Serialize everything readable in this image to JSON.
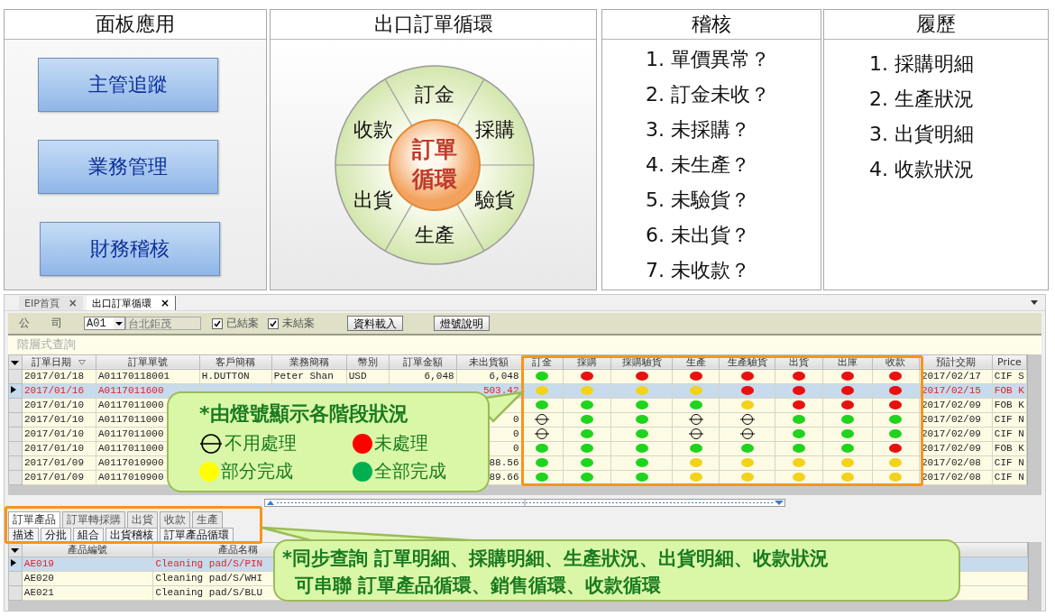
{
  "dashboard": {
    "panel_apps": {
      "title": "面板應用",
      "buttons": [
        "主管追蹤",
        "業務管理",
        "財務稽核"
      ]
    },
    "cycle": {
      "title": "出口訂單循環",
      "center": "訂單循環",
      "segments": [
        "訂金",
        "採購",
        "驗貨",
        "生產",
        "出貨",
        "收款"
      ]
    },
    "audit": {
      "title": "稽核",
      "items": [
        "1. 單價異常？",
        "2. 訂金未收？",
        "3. 未採購？",
        "4. 未生產？",
        "5. 未驗貨？",
        "6. 未出貨？",
        "7. 未收款？"
      ]
    },
    "history": {
      "title": "履歷",
      "items": [
        "1. 採購明細",
        "2. 生產狀況",
        "3. 出貨明細",
        "4. 收款狀況"
      ]
    }
  },
  "app": {
    "tabs": [
      {
        "label": "EIP首頁",
        "close": "×",
        "selected": false
      },
      {
        "label": "出口訂單循環",
        "close": "×",
        "selected": true
      }
    ],
    "toolbar": {
      "company_label": "公　　司",
      "company_code": "A01",
      "company_name": "台北鉅茂",
      "filters": [
        {
          "label": "已結案",
          "checked": true
        },
        {
          "label": "未結案",
          "checked": true
        }
      ],
      "buttons": [
        "資料載入",
        "燈號說明"
      ]
    },
    "group_hint": "階層式查詢",
    "orders": {
      "columns": [
        {
          "label": "訂單日期",
          "kind": "text",
          "sortable": true
        },
        {
          "label": "訂單單號",
          "kind": "text",
          "sortable": false
        },
        {
          "label": "客戶簡稱",
          "kind": "text",
          "sortable": false
        },
        {
          "label": "業務簡稱",
          "kind": "text",
          "sortable": false
        },
        {
          "label": "幣別",
          "kind": "text",
          "sortable": false
        },
        {
          "label": "訂單金額",
          "kind": "number",
          "sortable": false
        },
        {
          "label": "未出貨額",
          "kind": "number",
          "sortable": false
        },
        {
          "label": "訂金",
          "kind": "light",
          "sortable": false
        },
        {
          "label": "採購",
          "kind": "light",
          "sortable": false
        },
        {
          "label": "採購驗貨",
          "kind": "light",
          "sortable": false
        },
        {
          "label": "生產",
          "kind": "light",
          "sortable": false
        },
        {
          "label": "生產驗貨",
          "kind": "light",
          "sortable": false
        },
        {
          "label": "出貨",
          "kind": "light",
          "sortable": false
        },
        {
          "label": "出庫",
          "kind": "light",
          "sortable": false
        },
        {
          "label": "收款",
          "kind": "light",
          "sortable": false
        },
        {
          "label": "預計交期",
          "kind": "text",
          "sortable": false
        },
        {
          "label": "Price",
          "kind": "text",
          "sortable": false
        }
      ],
      "rows": [
        {
          "selected": false,
          "cells": [
            "2017/01/18",
            "A01170118001",
            "H.DUTTON",
            "Peter Shan",
            "USD",
            "6,048",
            "6,048",
            {
              "kind": "dot",
              "color": "#1ed41e"
            },
            {
              "kind": "dot",
              "color": "#e81010"
            },
            {
              "kind": "dot",
              "color": "#e81010"
            },
            {
              "kind": "dot",
              "color": "#e81010"
            },
            {
              "kind": "dot",
              "color": "#e81010"
            },
            {
              "kind": "dot",
              "color": "#e81010"
            },
            {
              "kind": "dot",
              "color": "#e81010"
            },
            {
              "kind": "dot",
              "color": "#e81010"
            },
            "2017/02/17",
            "CIF S"
          ]
        },
        {
          "selected": true,
          "cells": [
            "2017/01/16",
            "A0117011600",
            null,
            null,
            null,
            null,
            "503.42",
            {
              "kind": "dot",
              "color": "#f2d21b"
            },
            {
              "kind": "dot",
              "color": "#f2d21b"
            },
            {
              "kind": "dot",
              "color": "#f2d21b"
            },
            {
              "kind": "dot",
              "color": "#f2d21b"
            },
            {
              "kind": "dot",
              "color": "#e81010"
            },
            {
              "kind": "dot",
              "color": "#e81010"
            },
            {
              "kind": "dot",
              "color": "#e81010"
            },
            {
              "kind": "dot",
              "color": "#e81010"
            },
            "2017/02/15",
            "FOB K"
          ]
        },
        {
          "selected": false,
          "cells": [
            "2017/01/10",
            "A0117011000",
            null,
            null,
            null,
            null,
            null,
            {
              "kind": "dot",
              "color": "#1ed41e"
            },
            {
              "kind": "dot",
              "color": "#1ed41e"
            },
            {
              "kind": "dot",
              "color": "#1ed41e"
            },
            {
              "kind": "dot",
              "color": "#1ed41e"
            },
            {
              "kind": "dot",
              "color": "#f2d21b"
            },
            {
              "kind": "dot",
              "color": "#e81010"
            },
            {
              "kind": "dot",
              "color": "#e81010"
            },
            {
              "kind": "dot",
              "color": "#e81010"
            },
            "2017/02/09",
            "FOB K"
          ]
        },
        {
          "selected": false,
          "cells": [
            "2017/01/10",
            "A0117011000",
            null,
            null,
            null,
            null,
            "0",
            {
              "kind": "none"
            },
            {
              "kind": "dot",
              "color": "#1ed41e"
            },
            {
              "kind": "dot",
              "color": "#1ed41e"
            },
            {
              "kind": "none"
            },
            {
              "kind": "none"
            },
            {
              "kind": "dot",
              "color": "#1ed41e"
            },
            {
              "kind": "dot",
              "color": "#1ed41e"
            },
            {
              "kind": "dot",
              "color": "#1ed41e"
            },
            "2017/02/09",
            "CIF N"
          ]
        },
        {
          "selected": false,
          "cells": [
            "2017/01/10",
            "A0117011000",
            null,
            null,
            null,
            null,
            "0",
            {
              "kind": "none"
            },
            {
              "kind": "dot",
              "color": "#1ed41e"
            },
            {
              "kind": "dot",
              "color": "#1ed41e"
            },
            {
              "kind": "none"
            },
            {
              "kind": "none"
            },
            {
              "kind": "dot",
              "color": "#1ed41e"
            },
            {
              "kind": "dot",
              "color": "#1ed41e"
            },
            {
              "kind": "dot",
              "color": "#1ed41e"
            },
            "2017/02/09",
            "CIF N"
          ]
        },
        {
          "selected": false,
          "cells": [
            "2017/01/10",
            "A0117011000",
            null,
            null,
            null,
            null,
            "0",
            {
              "kind": "dot",
              "color": "#1ed41e"
            },
            {
              "kind": "dot",
              "color": "#1ed41e"
            },
            {
              "kind": "dot",
              "color": "#1ed41e"
            },
            {
              "kind": "dot",
              "color": "#1ed41e"
            },
            {
              "kind": "dot",
              "color": "#1ed41e"
            },
            {
              "kind": "dot",
              "color": "#1ed41e"
            },
            {
              "kind": "dot",
              "color": "#1ed41e"
            },
            {
              "kind": "dot",
              "color": "#e81010"
            },
            "2017/02/09",
            "FOB K"
          ]
        },
        {
          "selected": false,
          "cells": [
            "2017/01/09",
            "A0117010900",
            null,
            null,
            null,
            null,
            "88.56",
            {
              "kind": "dot",
              "color": "#1ed41e"
            },
            {
              "kind": "dot",
              "color": "#1ed41e"
            },
            {
              "kind": "dot",
              "color": "#1ed41e"
            },
            {
              "kind": "dot",
              "color": "#f2d21b"
            },
            {
              "kind": "dot",
              "color": "#f2d21b"
            },
            {
              "kind": "dot",
              "color": "#f2d21b"
            },
            {
              "kind": "dot",
              "color": "#f2d21b"
            },
            {
              "kind": "dot",
              "color": "#f2d21b"
            },
            "2017/02/08",
            "CIF N"
          ]
        },
        {
          "selected": false,
          "cells": [
            "2017/01/09",
            "A0117010900",
            null,
            null,
            null,
            null,
            "89.66",
            {
              "kind": "dot",
              "color": "#1ed41e"
            },
            {
              "kind": "dot",
              "color": "#1ed41e"
            },
            {
              "kind": "dot",
              "color": "#1ed41e"
            },
            {
              "kind": "dot",
              "color": "#f2d21b"
            },
            {
              "kind": "dot",
              "color": "#f2d21b"
            },
            {
              "kind": "dot",
              "color": "#f2d21b"
            },
            {
              "kind": "dot",
              "color": "#f2d21b"
            },
            {
              "kind": "dot",
              "color": "#f2d21b"
            },
            "2017/02/08",
            "CIF N"
          ]
        }
      ]
    },
    "detail": {
      "tabs": [
        {
          "label": "訂單產品",
          "selected": true
        },
        {
          "label": "訂單轉採購",
          "selected": false
        },
        {
          "label": "出貨",
          "selected": false
        },
        {
          "label": "收款",
          "selected": false
        },
        {
          "label": "生產",
          "selected": false
        }
      ],
      "actions": [
        "描述",
        "分批",
        "組合",
        "出貨稽核",
        "訂單產品循環"
      ],
      "columns": [
        "產品編號",
        "產品名稱"
      ],
      "rows": [
        {
          "selected": true,
          "cells": [
            "AE019",
            "Cleaning pad/S/PIN"
          ]
        },
        {
          "selected": false,
          "cells": [
            "AE020",
            "Cleaning pad/S/WHI"
          ]
        },
        {
          "selected": false,
          "cells": [
            "AE021",
            "Cleaning pad/S/BLU"
          ]
        }
      ]
    },
    "lights_note": {
      "title": "*由燈號顯示各階段狀況",
      "legend": [
        {
          "kind": "none",
          "label": "不用處理"
        },
        {
          "kind": "dot",
          "color": "#ff0000",
          "label": "未處理"
        },
        {
          "kind": "dot",
          "color": "#ffff00",
          "label": "部分完成"
        },
        {
          "kind": "dot",
          "color": "#00b050",
          "label": "全部完成"
        }
      ]
    },
    "sync_note": {
      "lines": [
        "*同步查詢 訂單明細、採購明細、生產狀況、出貨明細、收款狀況",
        "可串聯 訂單產品循環、銷售循環、收款循環"
      ]
    }
  }
}
